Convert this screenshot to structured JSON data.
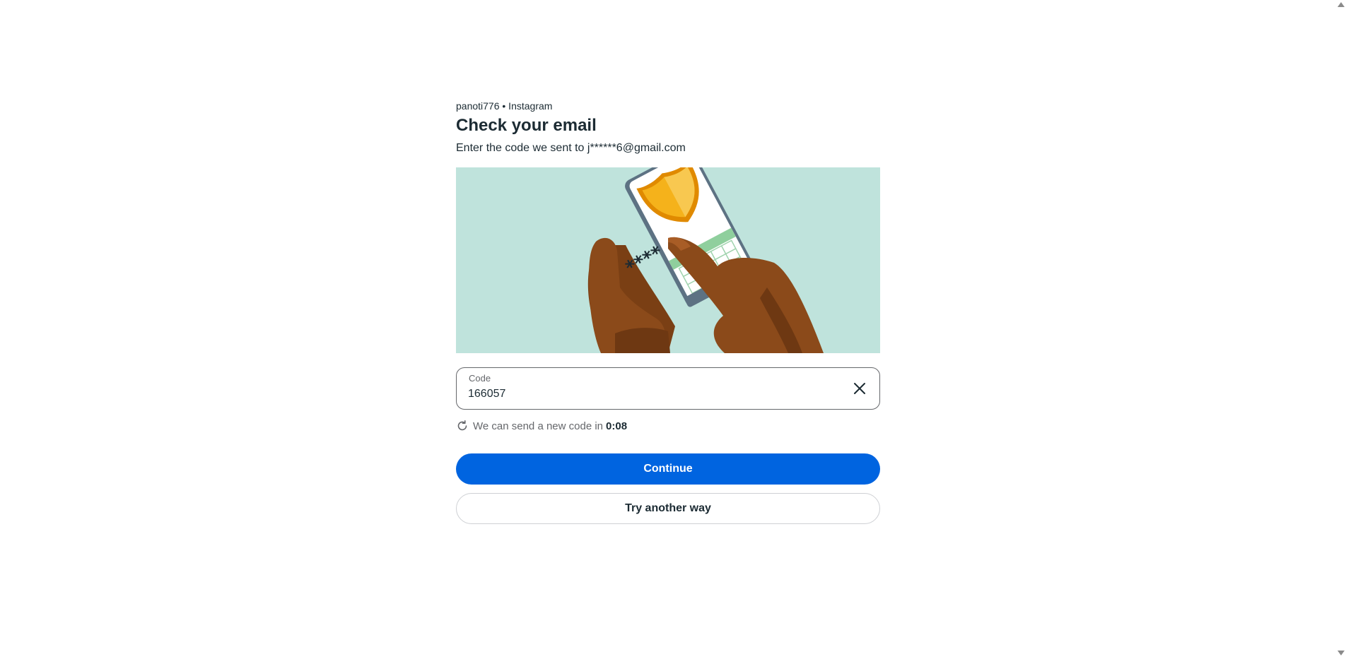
{
  "header": {
    "account_line": "panoti776 • Instagram",
    "title": "Check your email",
    "subtitle": "Enter the code we sent to j******6@gmail.com"
  },
  "illustration": {
    "icon": "phone-shield-illustration",
    "masked_text": "****"
  },
  "code_field": {
    "label": "Code",
    "value": "166057"
  },
  "resend": {
    "text": "We can send a new code in",
    "timer": "0:08"
  },
  "buttons": {
    "continue_label": "Continue",
    "try_another_label": "Try another way"
  },
  "colors": {
    "primary": "#0064e0",
    "illustration_bg": "#bfe3dc",
    "shield": "#f5b21b"
  }
}
